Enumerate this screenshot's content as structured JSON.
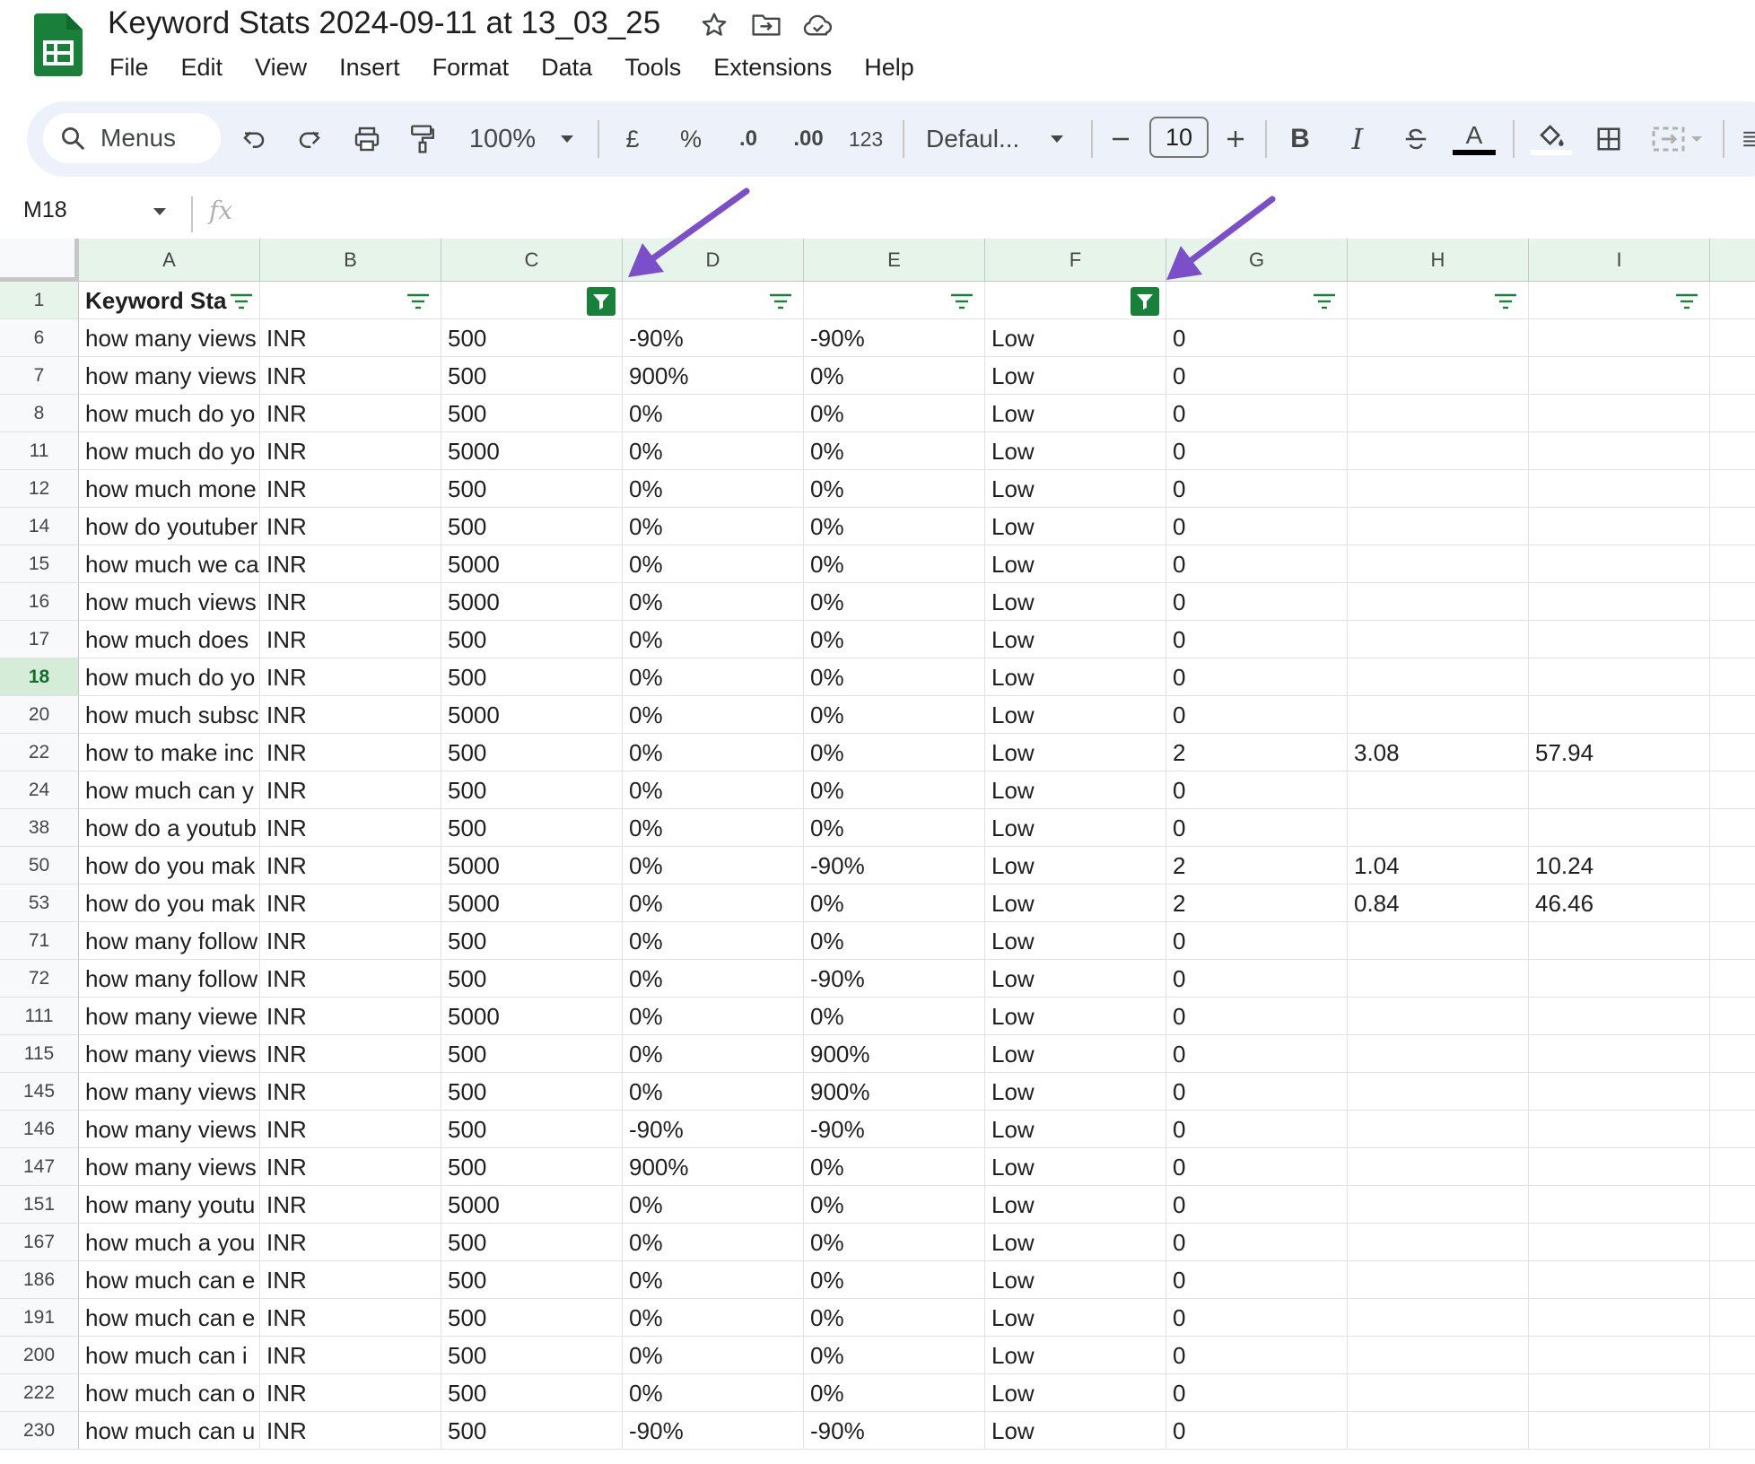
{
  "doc": {
    "title": "Keyword Stats 2024-09-11 at 13_03_25"
  },
  "menu": [
    "File",
    "Edit",
    "View",
    "Insert",
    "Format",
    "Data",
    "Tools",
    "Extensions",
    "Help"
  ],
  "toolbar": {
    "search_label": "Menus",
    "zoom": "100%",
    "currency": "£",
    "percent": "%",
    "dec_decrease": ".0",
    "dec_increase": ".00",
    "number_format": "123",
    "font": "Defaul...",
    "font_size": "10",
    "bold": "B",
    "italic": "I",
    "text_color": "A"
  },
  "formula_bar": {
    "cell_ref": "M18",
    "fx": "fx"
  },
  "columns": [
    "A",
    "B",
    "C",
    "D",
    "E",
    "F",
    "G",
    "H",
    "I"
  ],
  "header_row": {
    "num": "1",
    "a": "Keyword Sta"
  },
  "rows": [
    {
      "n": "6",
      "a": "how many views",
      "b": "INR",
      "c": "500",
      "d": "-90%",
      "e": "-90%",
      "f": "Low",
      "g": "0",
      "h": "",
      "i": ""
    },
    {
      "n": "7",
      "a": "how many views",
      "b": "INR",
      "c": "500",
      "d": "900%",
      "e": "0%",
      "f": "Low",
      "g": "0",
      "h": "",
      "i": ""
    },
    {
      "n": "8",
      "a": "how much do yo",
      "b": "INR",
      "c": "500",
      "d": "0%",
      "e": "0%",
      "f": "Low",
      "g": "0",
      "h": "",
      "i": ""
    },
    {
      "n": "11",
      "a": "how much do yo",
      "b": "INR",
      "c": "5000",
      "d": "0%",
      "e": "0%",
      "f": "Low",
      "g": "0",
      "h": "",
      "i": ""
    },
    {
      "n": "12",
      "a": "how much mone",
      "b": "INR",
      "c": "500",
      "d": "0%",
      "e": "0%",
      "f": "Low",
      "g": "0",
      "h": "",
      "i": ""
    },
    {
      "n": "14",
      "a": "how do youtuber",
      "b": "INR",
      "c": "500",
      "d": "0%",
      "e": "0%",
      "f": "Low",
      "g": "0",
      "h": "",
      "i": ""
    },
    {
      "n": "15",
      "a": "how much we ca",
      "b": "INR",
      "c": "5000",
      "d": "0%",
      "e": "0%",
      "f": "Low",
      "g": "0",
      "h": "",
      "i": ""
    },
    {
      "n": "16",
      "a": "how much views",
      "b": "INR",
      "c": "5000",
      "d": "0%",
      "e": "0%",
      "f": "Low",
      "g": "0",
      "h": "",
      "i": ""
    },
    {
      "n": "17",
      "a": "how much does",
      "b": "INR",
      "c": "500",
      "d": "0%",
      "e": "0%",
      "f": "Low",
      "g": "0",
      "h": "",
      "i": ""
    },
    {
      "n": "18",
      "a": "how much do yo",
      "b": "INR",
      "c": "500",
      "d": "0%",
      "e": "0%",
      "f": "Low",
      "g": "0",
      "h": "",
      "i": ""
    },
    {
      "n": "20",
      "a": "how much subsc",
      "b": "INR",
      "c": "5000",
      "d": "0%",
      "e": "0%",
      "f": "Low",
      "g": "0",
      "h": "",
      "i": ""
    },
    {
      "n": "22",
      "a": "how to make inc",
      "b": "INR",
      "c": "500",
      "d": "0%",
      "e": "0%",
      "f": "Low",
      "g": "2",
      "h": "3.08",
      "i": "57.94"
    },
    {
      "n": "24",
      "a": "how much can y",
      "b": "INR",
      "c": "500",
      "d": "0%",
      "e": "0%",
      "f": "Low",
      "g": "0",
      "h": "",
      "i": ""
    },
    {
      "n": "38",
      "a": "how do a youtub",
      "b": "INR",
      "c": "500",
      "d": "0%",
      "e": "0%",
      "f": "Low",
      "g": "0",
      "h": "",
      "i": ""
    },
    {
      "n": "50",
      "a": "how do you mak",
      "b": "INR",
      "c": "5000",
      "d": "0%",
      "e": "-90%",
      "f": "Low",
      "g": "2",
      "h": "1.04",
      "i": "10.24"
    },
    {
      "n": "53",
      "a": "how do you mak",
      "b": "INR",
      "c": "5000",
      "d": "0%",
      "e": "0%",
      "f": "Low",
      "g": "2",
      "h": "0.84",
      "i": "46.46"
    },
    {
      "n": "71",
      "a": "how many follow",
      "b": "INR",
      "c": "500",
      "d": "0%",
      "e": "0%",
      "f": "Low",
      "g": "0",
      "h": "",
      "i": ""
    },
    {
      "n": "72",
      "a": "how many follow",
      "b": "INR",
      "c": "500",
      "d": "0%",
      "e": "-90%",
      "f": "Low",
      "g": "0",
      "h": "",
      "i": ""
    },
    {
      "n": "111",
      "a": "how many viewe",
      "b": "INR",
      "c": "5000",
      "d": "0%",
      "e": "0%",
      "f": "Low",
      "g": "0",
      "h": "",
      "i": ""
    },
    {
      "n": "115",
      "a": "how many views",
      "b": "INR",
      "c": "500",
      "d": "0%",
      "e": "900%",
      "f": "Low",
      "g": "0",
      "h": "",
      "i": ""
    },
    {
      "n": "145",
      "a": "how many views",
      "b": "INR",
      "c": "500",
      "d": "0%",
      "e": "900%",
      "f": "Low",
      "g": "0",
      "h": "",
      "i": ""
    },
    {
      "n": "146",
      "a": "how many views",
      "b": "INR",
      "c": "500",
      "d": "-90%",
      "e": "-90%",
      "f": "Low",
      "g": "0",
      "h": "",
      "i": ""
    },
    {
      "n": "147",
      "a": "how many views",
      "b": "INR",
      "c": "500",
      "d": "900%",
      "e": "0%",
      "f": "Low",
      "g": "0",
      "h": "",
      "i": ""
    },
    {
      "n": "151",
      "a": "how many youtu",
      "b": "INR",
      "c": "5000",
      "d": "0%",
      "e": "0%",
      "f": "Low",
      "g": "0",
      "h": "",
      "i": ""
    },
    {
      "n": "167",
      "a": "how much a you",
      "b": "INR",
      "c": "500",
      "d": "0%",
      "e": "0%",
      "f": "Low",
      "g": "0",
      "h": "",
      "i": ""
    },
    {
      "n": "186",
      "a": "how much can e",
      "b": "INR",
      "c": "500",
      "d": "0%",
      "e": "0%",
      "f": "Low",
      "g": "0",
      "h": "",
      "i": ""
    },
    {
      "n": "191",
      "a": "how much can e",
      "b": "INR",
      "c": "500",
      "d": "0%",
      "e": "0%",
      "f": "Low",
      "g": "0",
      "h": "",
      "i": ""
    },
    {
      "n": "200",
      "a": "how much can i",
      "b": "INR",
      "c": "500",
      "d": "0%",
      "e": "0%",
      "f": "Low",
      "g": "0",
      "h": "",
      "i": ""
    },
    {
      "n": "222",
      "a": "how much can o",
      "b": "INR",
      "c": "500",
      "d": "0%",
      "e": "0%",
      "f": "Low",
      "g": "0",
      "h": "",
      "i": ""
    },
    {
      "n": "230",
      "a": "how much can u",
      "b": "INR",
      "c": "500",
      "d": "-90%",
      "e": "-90%",
      "f": "Low",
      "g": "0",
      "h": "",
      "i": ""
    }
  ],
  "colors": {
    "filter_active": "#188038",
    "header_green": "#e6f4ea",
    "annotation_arrow": "#7b4fc9"
  }
}
